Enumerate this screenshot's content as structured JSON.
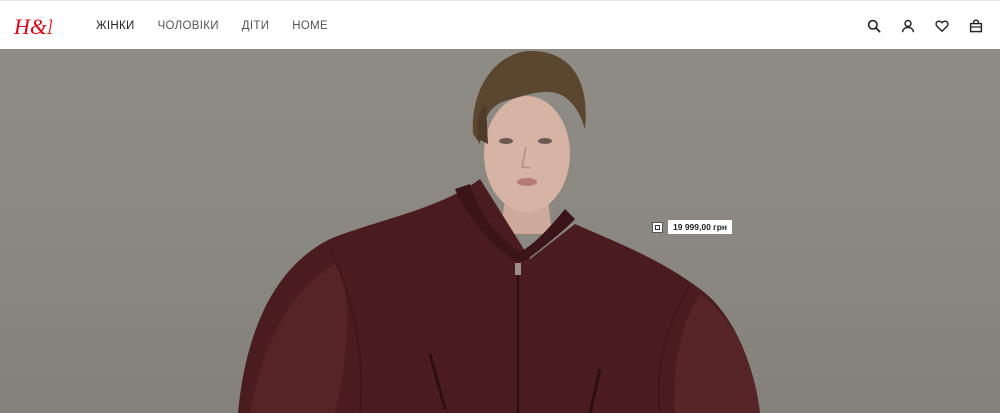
{
  "header": {
    "logo_text": "H&M",
    "brand_color": "#e50010",
    "nav": [
      {
        "label": "ЖІНКИ",
        "active": true
      },
      {
        "label": "ЧОЛОВІКИ",
        "active": false
      },
      {
        "label": "ДІТИ",
        "active": false
      },
      {
        "label": "HOME",
        "active": false
      }
    ],
    "icons": [
      "search-icon",
      "account-icon",
      "favorites-icon",
      "shopping-bag-icon"
    ]
  },
  "hero": {
    "product_tag": {
      "price": "19 999,00 грн"
    },
    "colors": {
      "background": "#8c8983",
      "jacket": "#4a1c1f"
    }
  }
}
